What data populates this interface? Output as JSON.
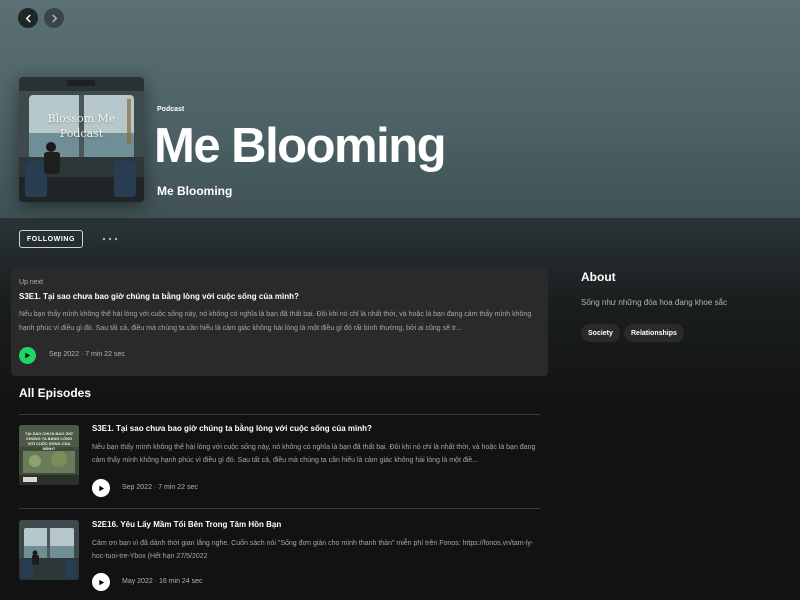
{
  "nav": {
    "back_icon": "chevron-left-icon",
    "forward_icon": "chevron-right-icon"
  },
  "show": {
    "cover_title": "Blossom Me\nPodcast",
    "type_label": "Podcast",
    "title": "Me Blooming",
    "publisher": "Me Blooming"
  },
  "actions": {
    "follow_label": "FOLLOWING",
    "more_icon": "more-horizontal-icon"
  },
  "up_next": {
    "label": "Up next",
    "title": "S3E1. Tại sao chưa bao giờ chúng ta bằng lòng với cuộc sống của mình?",
    "description": "Nếu bạn thấy mình không thể hài lòng với cuộc sống này, nó không có nghĩa là bạn đã thất bại. Đôi khi nó chỉ là nhất thời, và hoặc là bạn đang cảm thấy mình không hạnh phúc vì điều gì đó. Sau tất cả, điều mà chúng ta cần hiểu là cảm giác không hài lòng là một điều gì đó rất bình thường, bởi ai cũng sẽ tr...",
    "meta": "Sep 2022 · 7 min 22 sec",
    "accent_color": "#1ed760"
  },
  "episodes_heading": "All Episodes",
  "episodes": [
    {
      "thumb_text": "TẠI SAO CHƯA BAO GIỜ CHÚNG TA BẰNG LÒNG VỚI CUỘC SỐNG CỦA MÌNH?",
      "title": "S3E1. Tại sao chưa bao giờ chúng ta bằng lòng với cuộc sống của mình?",
      "description": "Nếu bạn thấy mình không thể hài lòng với cuộc sống này, nó không có nghĩa là bạn đã thất bại. Đôi khi nó chỉ là nhất thời, và hoặc là bạn đang cảm thấy mình không hạnh phúc vì điều gì đó. Sau tất cả, điều mà chúng ta cần hiểu là cảm giác không hài lòng là một điề...",
      "meta": "Sep 2022 · 7 min 22 sec"
    },
    {
      "title": "S2E16. Yêu Lấy Mầm Tối Bên Trong Tâm Hồn Bạn",
      "description": "Cảm ơn bạn vì đã dành thời gian lắng nghe. Cuốn sách nói \"Sống đơn giản cho mình thanh thản\" miễn phí trên Fonos: https://fonos.vn/tam-ly-hoc-tuoi-tre-Ybox (Hết hạn 27/5/2022",
      "meta": "May 2022 · 16 min 24 sec"
    }
  ],
  "about": {
    "heading": "About",
    "text": "Sống như những đóa hoa đang khoe sắc",
    "tags": [
      "Society",
      "Relationships"
    ]
  }
}
